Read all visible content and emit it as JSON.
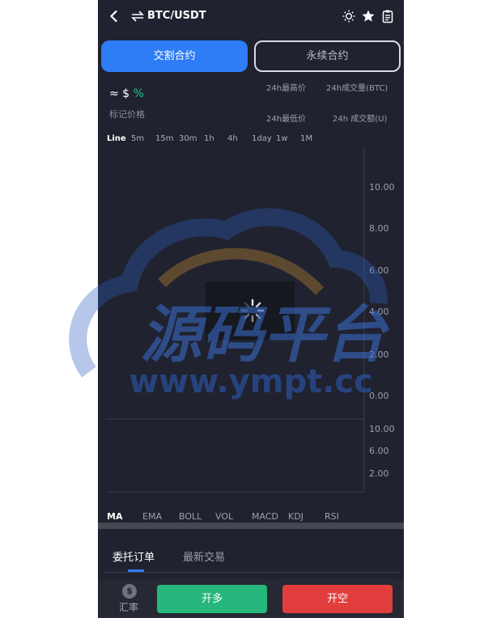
{
  "header": {
    "back_icon": "chevron-left-icon",
    "swap_icon": "swap-icon",
    "pair": "BTC/USDT",
    "icons": [
      "sun-icon",
      "star-icon",
      "clipboard-icon"
    ]
  },
  "contract_tabs": [
    {
      "label": "交割合约",
      "active": true
    },
    {
      "label": "永续合约",
      "active": false
    }
  ],
  "price": {
    "approx": "≈ $",
    "percent": "%",
    "mark_label": "标记价格"
  },
  "stats": {
    "high_24h": "24h最高价",
    "volume_btc": "24h成交量(BTC)",
    "low_24h": "24h最低价",
    "turnover_u": "24h 成交额(U)"
  },
  "periods": [
    "Line",
    "5m",
    "15m",
    "30m",
    "1h",
    "4h",
    "1day",
    "1w",
    "1M"
  ],
  "main_axis": [
    "10.00",
    "8.00",
    "6.00",
    "4.00",
    "2.00",
    "0.00"
  ],
  "sub_axis": [
    "10.00",
    "6.00",
    "2.00"
  ],
  "indicators": [
    "MA",
    "EMA",
    "BOLL",
    "VOL",
    "MACD",
    "KDJ",
    "RSI"
  ],
  "order_tabs": [
    {
      "label": "委托订单",
      "active": true
    },
    {
      "label": "最新交易",
      "active": false
    }
  ],
  "bottom": {
    "rate_icon": "dollar-coin-icon",
    "rate_label": "汇率",
    "long_label": "开多",
    "short_label": "开空"
  },
  "watermark": {
    "title": "源码平台",
    "url": "www.ympt.cc"
  },
  "colors": {
    "accent": "#2e7cf6",
    "up": "#27b77c",
    "down": "#e23d3d",
    "background": "#20222f"
  }
}
